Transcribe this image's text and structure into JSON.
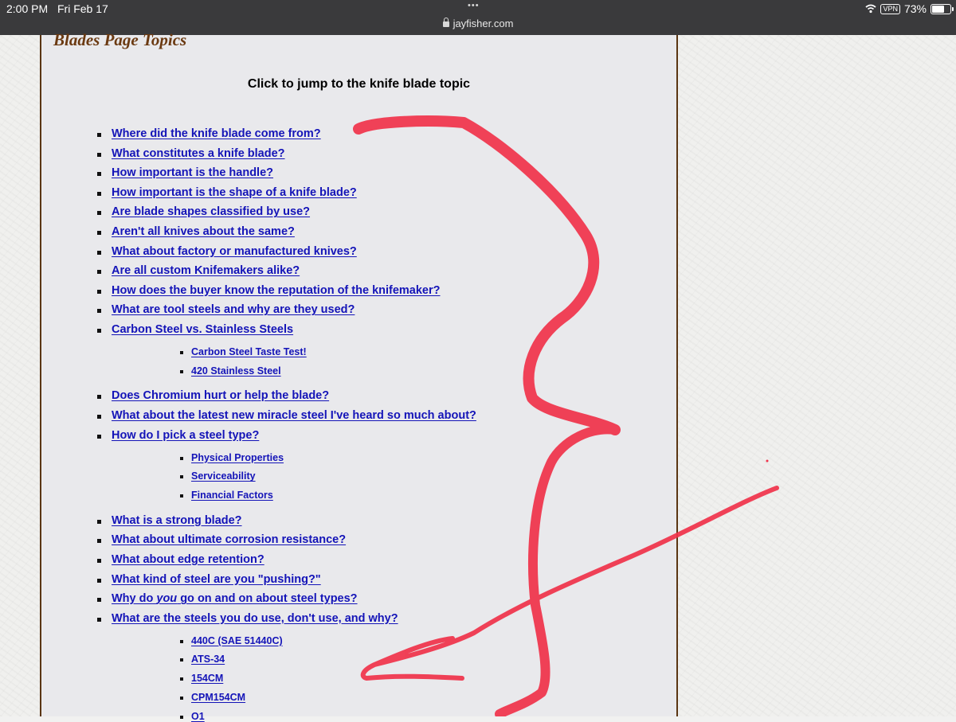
{
  "status_bar": {
    "time": "2:00 PM",
    "date": "Fri Feb 17",
    "dots": "•••",
    "url": "jayfisher.com",
    "vpn": "VPN",
    "battery": "73%",
    "battery_level": 0.73
  },
  "page": {
    "section_title": "Blades Page Topics",
    "subtitle": "Click to jump to the knife blade topic",
    "topics": [
      {
        "label": "Where did the knife blade come from?"
      },
      {
        "label": "What constitutes a knife blade?"
      },
      {
        "label": "How important is the handle?"
      },
      {
        "label": "How important is the shape of a knife blade?"
      },
      {
        "label": "Are blade shapes classified by use?"
      },
      {
        "label": "Aren't all knives about the same?"
      },
      {
        "label": "What about factory or manufactured knives?"
      },
      {
        "label": "Are all custom Knifemakers alike?"
      },
      {
        "label": "How does the buyer know the reputation of the knifemaker?"
      },
      {
        "label": "What are tool steels and why are they used?"
      },
      {
        "label": "Carbon Steel vs. Stainless Steels",
        "subs": [
          "Carbon Steel Taste Test!",
          "420 Stainless Steel"
        ]
      },
      {
        "label": "Does Chromium hurt or help the blade?"
      },
      {
        "label": "What about the latest new miracle steel I've heard so much about?"
      },
      {
        "label": "How do I pick a steel type?",
        "subs": [
          "Physical Properties",
          "Serviceability",
          "Financial Factors"
        ]
      },
      {
        "label": "What is a strong blade?"
      },
      {
        "label": "What about ultimate corrosion resistance?"
      },
      {
        "label": "What about edge retention?"
      },
      {
        "label": "What kind of steel are you \"pushing?\""
      },
      {
        "label": "Why do you go on and on about steel types?",
        "italic_word": "you"
      },
      {
        "label": "What are the steels you do use, don't use, and why?",
        "subs": [
          "440C (SAE 51440C)",
          "ATS-34",
          "154CM",
          "CPM154CM",
          "O1"
        ]
      }
    ]
  },
  "colors": {
    "link": "#1414b8",
    "title": "#6b3a12",
    "border": "#5a3512",
    "annotation": "#f0324a"
  }
}
